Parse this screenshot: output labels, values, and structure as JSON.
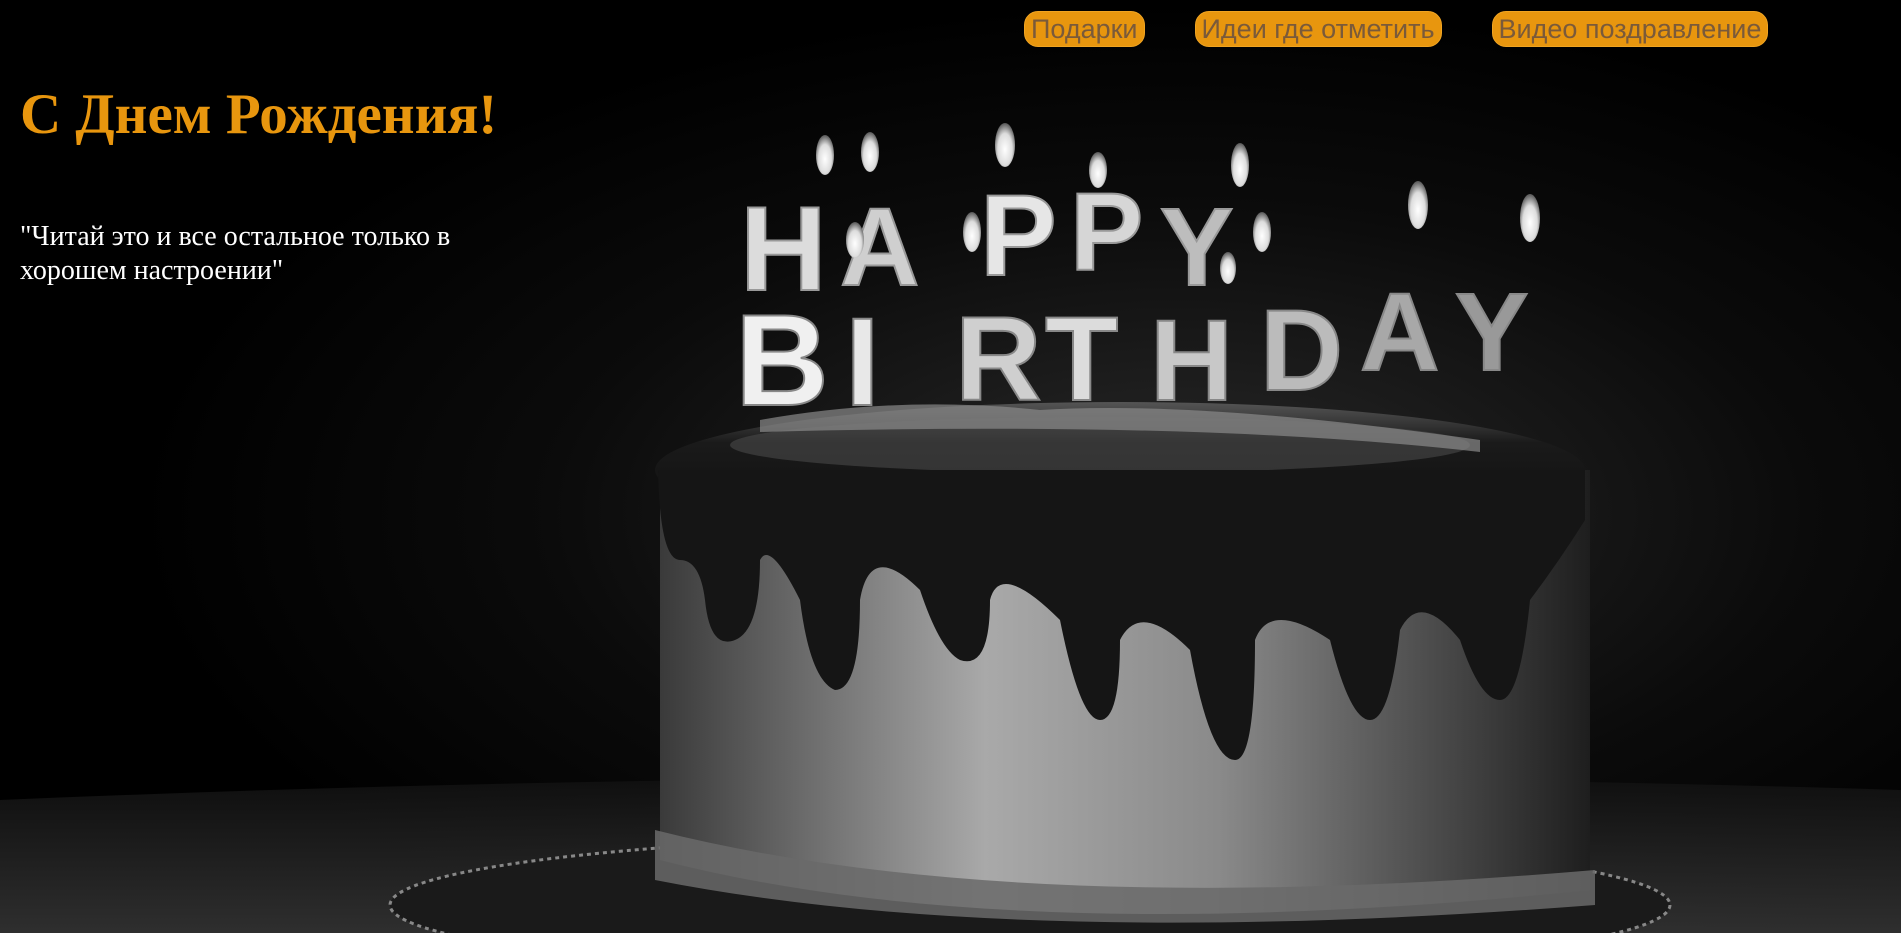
{
  "header": {
    "title": "С Днем Рождения!",
    "quote": "\"Читай это и все остальное только в хорошем настроении\""
  },
  "nav": {
    "items": [
      {
        "label": "Подарки"
      },
      {
        "label": "Идеи где отметить"
      },
      {
        "label": "Видео поздравление"
      }
    ]
  },
  "hero_image": {
    "subject": "birthday-cake-with-candles",
    "candle_line1": "HAPPY",
    "candle_line2": "BIRTHDAY"
  },
  "colors": {
    "accent": "#E8960E",
    "background": "#000000",
    "text": "#FFFFFF"
  }
}
